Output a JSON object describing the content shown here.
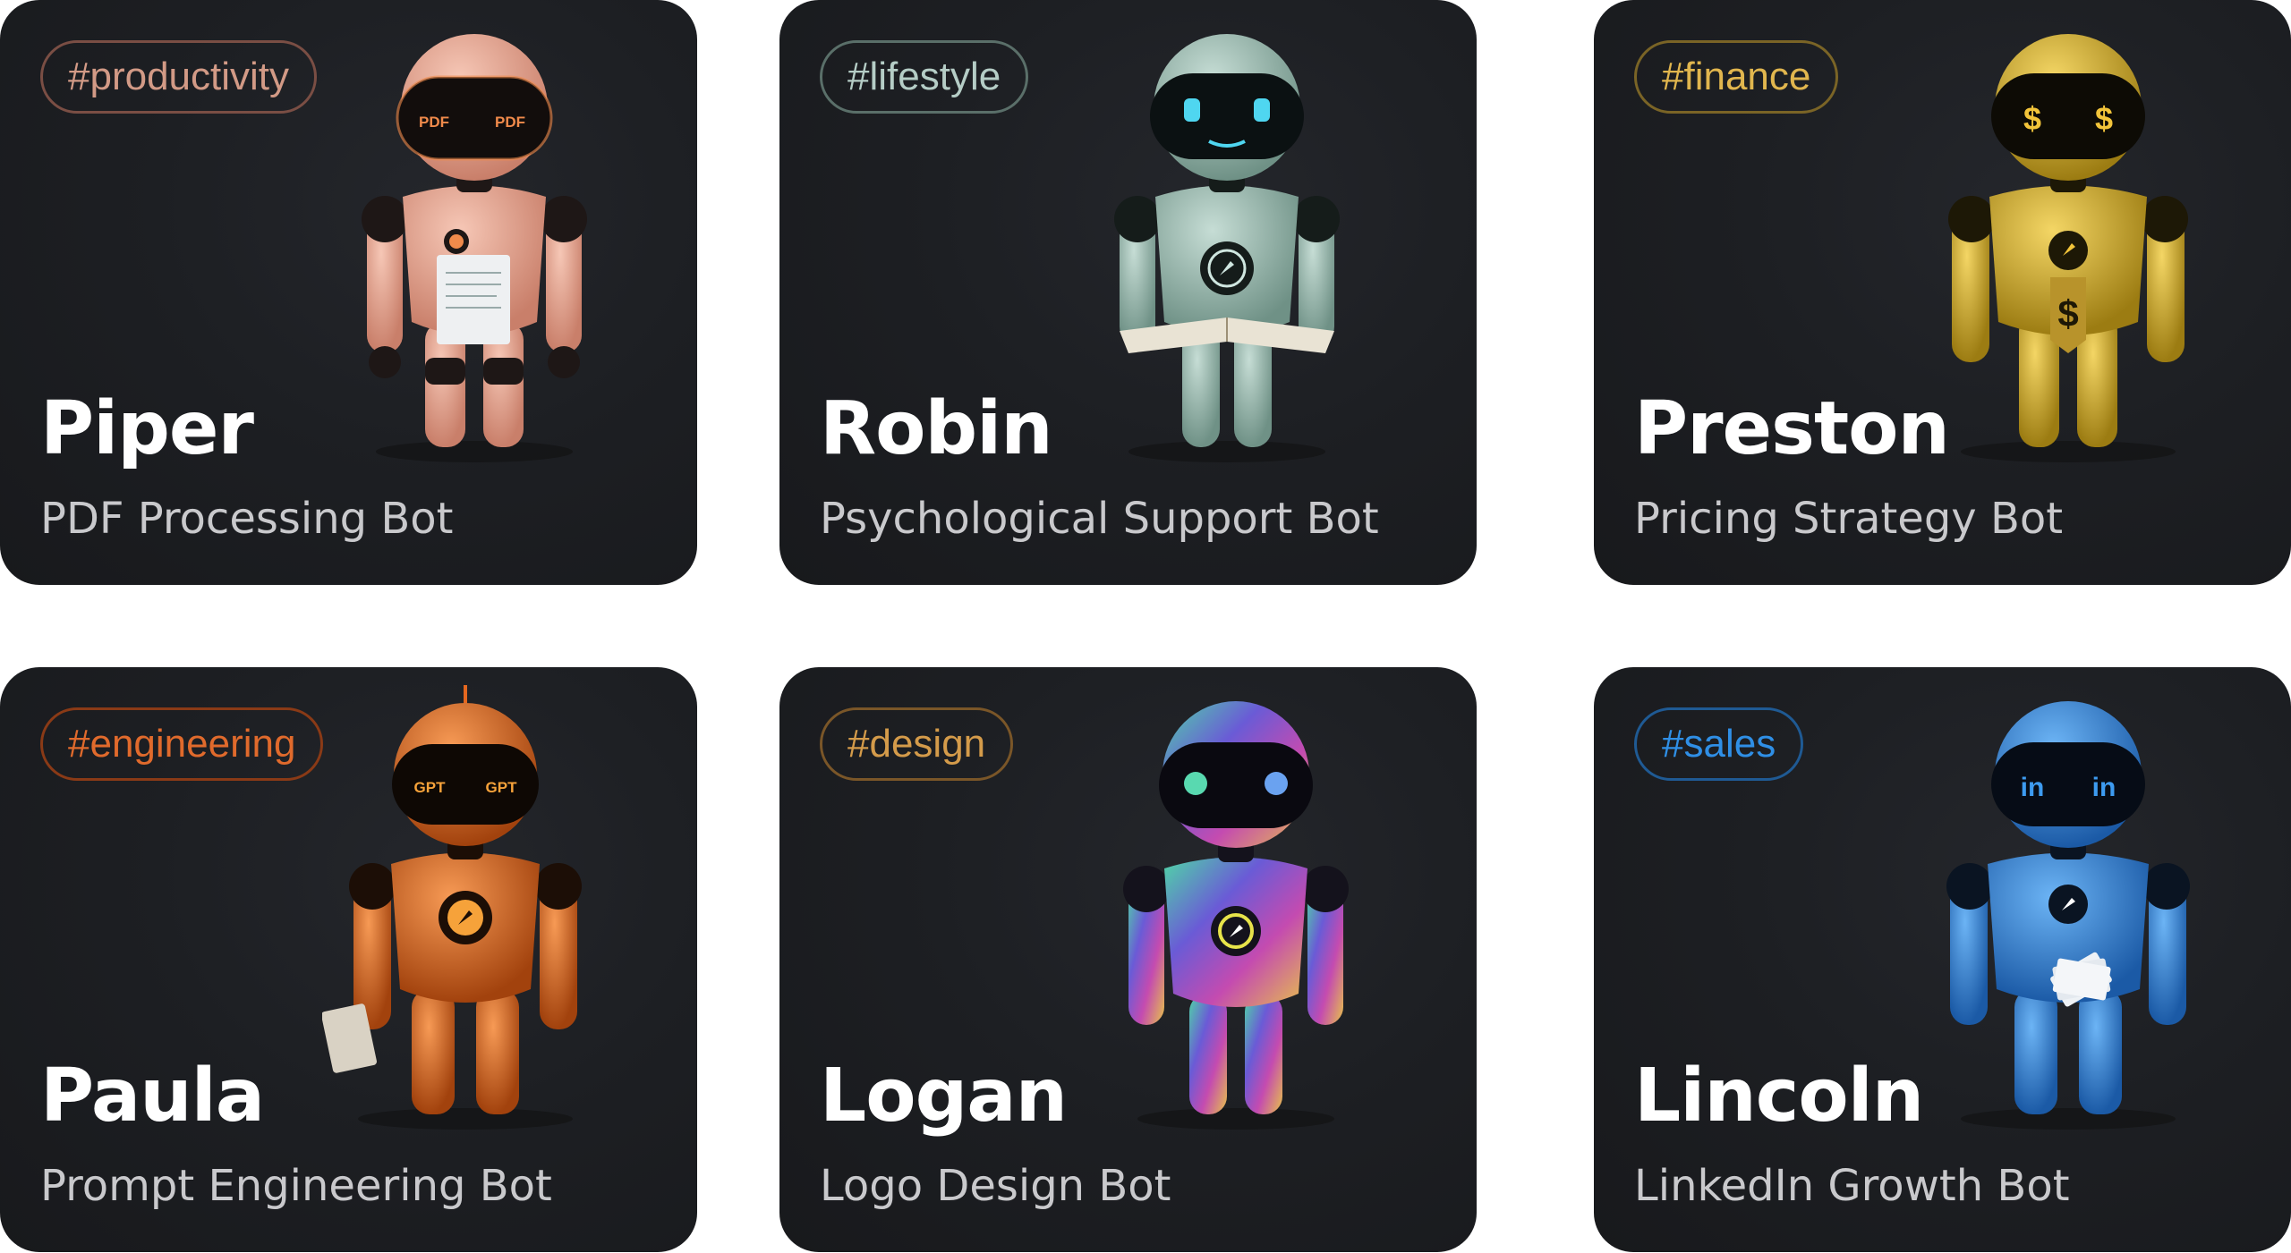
{
  "cards": [
    {
      "tag": "#productivity",
      "name": "Piper",
      "role": "PDF Processing Bot",
      "tag_color": "#d29a86",
      "tag_border": "#7a4e44",
      "robot_color": "#e8a893",
      "robot_dark": "#2a1e1c",
      "eye_text": "PDF",
      "eye_color": "#f08a4b",
      "prop": "paper-document",
      "badge_icon": "compass-icon"
    },
    {
      "tag": "#lifestyle",
      "name": "Robin",
      "role": "Psychological Support Bot",
      "tag_color": "#b5cdc6",
      "tag_border": "#5a6f69",
      "robot_color": "#9fbfb4",
      "robot_dark": "#1a2220",
      "eye_text": "",
      "eye_color": "#4fd6f0",
      "prop": "open-book",
      "badge_icon": "compass-icon"
    },
    {
      "tag": "#finance",
      "name": "Preston",
      "role": "Pricing Strategy Bot",
      "tag_color": "#e1b64e",
      "tag_border": "#7a6426",
      "robot_color": "#d8b32a",
      "robot_dark": "#221c08",
      "eye_text": "$",
      "eye_color": "#f2c43a",
      "prop": "price-tag",
      "badge_icon": "compass-icon"
    },
    {
      "tag": "#engineering",
      "name": "Paula",
      "role": "Prompt Engineering Bot",
      "tag_color": "#e06a2c",
      "tag_border": "#8a3a16",
      "robot_color": "#e5671f",
      "robot_dark": "#221007",
      "eye_text": "GPT",
      "eye_color": "#f6a23a",
      "prop": "notebook",
      "badge_icon": "compass-icon"
    },
    {
      "tag": "#design",
      "name": "Logan",
      "role": "Logo Design Bot",
      "tag_color": "#d49b4a",
      "tag_border": "#7a5628",
      "robot_color": "#7d6bd1",
      "robot_dark": "#14121c",
      "eye_text": "",
      "eye_color": "#59d9b0",
      "prop": "none",
      "badge_icon": "compass-icon"
    },
    {
      "tag": "#sales",
      "name": "Lincoln",
      "role": "LinkedIn Growth Bot",
      "tag_color": "#2f8fe6",
      "tag_border": "#1f5a94",
      "robot_color": "#2f7fd6",
      "robot_dark": "#0a1422",
      "eye_text": "in",
      "eye_color": "#3d9bf0",
      "prop": "business-cards",
      "badge_icon": "compass-icon"
    }
  ]
}
